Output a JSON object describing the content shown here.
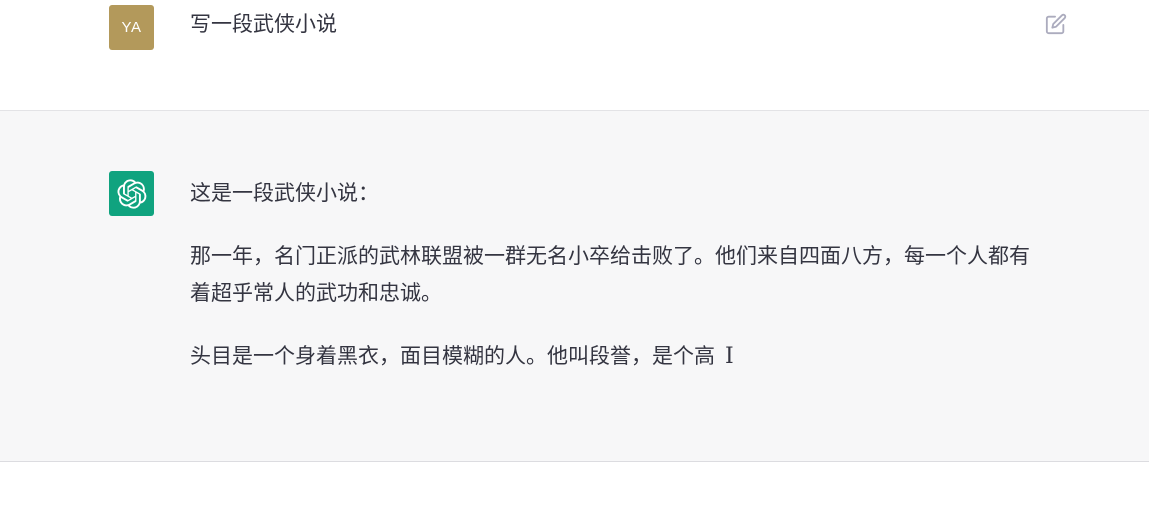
{
  "user_message": {
    "avatar_initials": "YA",
    "avatar_color": "#b3995b",
    "text": "写一段武侠小说",
    "edit_icon": "edit-icon"
  },
  "assistant_message": {
    "avatar_icon": "openai-logo-icon",
    "avatar_color": "#10a37f",
    "paragraphs": [
      "这是一段武侠小说：",
      "那一年，名门正派的武林联盟被一群无名小卒给击败了。他们来自四面八方，每一个人都有着超乎常人的武功和忠诚。",
      "头目是一个身着黑衣，面目模糊的人。他叫段誉，是个高"
    ],
    "text_cursor": "I"
  }
}
